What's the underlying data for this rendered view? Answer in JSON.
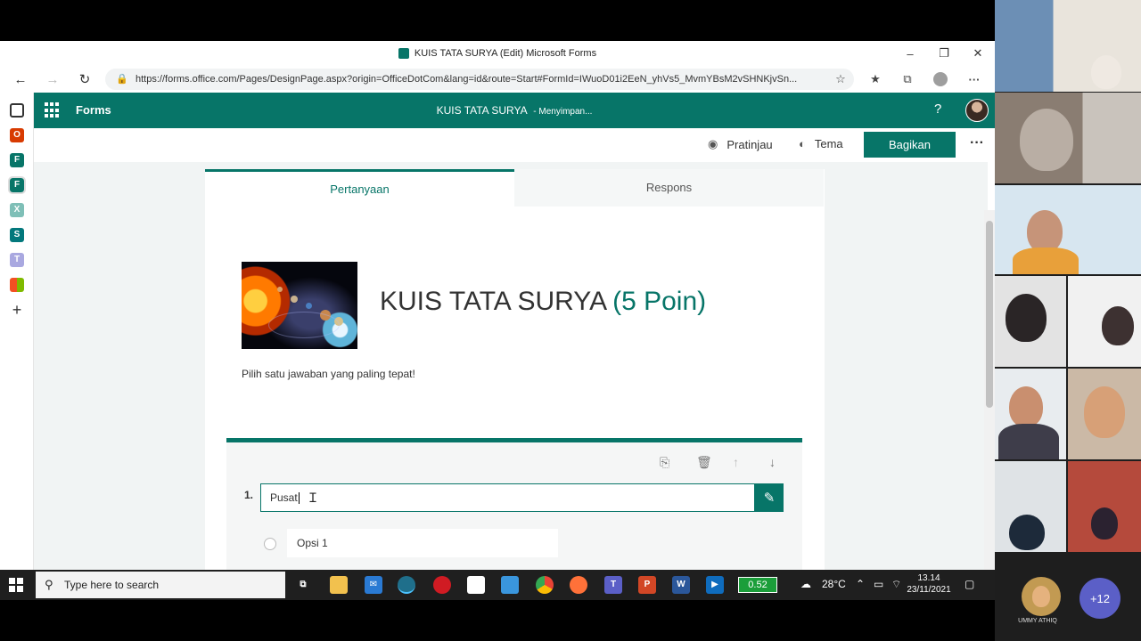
{
  "window": {
    "title": "KUIS TATA SURYA (Edit) Microsoft Forms",
    "minimize": "–",
    "restore": "❐",
    "close": "✕"
  },
  "browser": {
    "url": "https://forms.office.com/Pages/DesignPage.aspx?origin=OfficeDotCom&lang=id&route=Start#FormId=IWuoD01i2EeN_yhVs5_MvmYBsM2vSHNKjvSn...",
    "back": "←",
    "forward": "→",
    "refresh": "↻",
    "lock": "🔒"
  },
  "forms_header": {
    "app_name": "Forms",
    "form_title": "KUIS TATA SURYA",
    "saving_status": "- Menyimpan...",
    "help": "?"
  },
  "command_bar": {
    "preview_label": "Pratinjau",
    "theme_label": "Tema",
    "share_label": "Bagikan",
    "more": "···"
  },
  "tabs": [
    {
      "label": "Pertanyaan",
      "active": true
    },
    {
      "label": "Respons",
      "active": false
    }
  ],
  "form": {
    "title": "KUIS TATA SURYA",
    "points": "(5 Poin)",
    "description": "Pilih satu jawaban yang paling tepat!"
  },
  "question": {
    "number": "1.",
    "text": "Pusat",
    "option1": "Opsi 1"
  },
  "video_panel": {
    "more_participants": "+12",
    "self_name": "UMMY ATHIQ"
  },
  "taskbar": {
    "search_placeholder": "Type here to search",
    "battery_value": "0.52",
    "temperature": "28°C",
    "time": "13.14",
    "date": "23/11/2021"
  },
  "colors": {
    "brand": "#077568",
    "taskbar": "#1f1f1f",
    "teams_badge": "#5b5fc7"
  }
}
